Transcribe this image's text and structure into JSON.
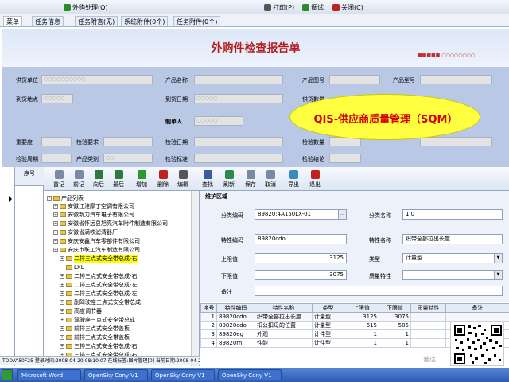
{
  "toolbar": {
    "items": [
      {
        "label": "外购处理(Q)",
        "color": "#2c8a2c"
      },
      {
        "label": "打印(P)",
        "color": "#333333"
      },
      {
        "label": "调试",
        "color": "#2c8a2c"
      },
      {
        "label": "关闭(C)",
        "color": "#c02020"
      }
    ]
  },
  "tabs": [
    {
      "label": "菜单",
      "active": true
    },
    {
      "label": "任务信息"
    },
    {
      "label": "任务附言(无)"
    },
    {
      "label": "系统附件(0个)"
    },
    {
      "label": "任务附件(0个)"
    }
  ],
  "form": {
    "title": "外购件检查报告单",
    "fields_row1": {
      "supplier_label": "供货单位",
      "supplier_value": "○○○○○○○○○○",
      "product_name_label": "产品名称",
      "drawing_no_label": "产品图号",
      "product_code_label": "产品型号"
    },
    "fields_row2": {
      "delivery_place_label": "到货地点",
      "delivery_value": "○○○○○",
      "date_label": "到货日期",
      "date_value": "○○○○○",
      "qty_label": "供货数量"
    },
    "fields_row3": {
      "creator_label": "制单人",
      "creator_value": "○○○○○"
    },
    "fields_row4": {
      "qty_inspect_label": "重要度",
      "req_label": "检验要求",
      "inspect_date_label": "检验日期",
      "check_qty_label": "检验数量"
    },
    "fields_row5": {
      "check_period_label": "检验周期",
      "category_label": "产品类别",
      "category_value": "○○",
      "standard_label": "检验标准",
      "conclusion_label": "检验结论"
    }
  },
  "qis_label": "QIS-供应商质量管理（SQM）",
  "left": {
    "header": "序号"
  },
  "actions": [
    {
      "label": "首记",
      "color": "#7a8aa6"
    },
    {
      "label": "前记",
      "color": "#7a8aa6"
    },
    {
      "label": "向后",
      "color": "#2c7a3c"
    },
    {
      "label": "最后",
      "color": "#2c7a3c"
    },
    {
      "label": "增加",
      "color": "#2c9a2c"
    },
    {
      "label": "删除",
      "color": "#c02020"
    },
    {
      "label": "编辑",
      "color": "#555555"
    },
    {
      "label": "查找",
      "color": "#3a5aa0"
    },
    {
      "label": "刷新",
      "color": "#2c8a4a"
    },
    {
      "label": "保存",
      "color": "#7a8aa6"
    },
    {
      "label": "取消",
      "color": "#7a8aa6"
    },
    {
      "label": "导出",
      "color": "#3a8ac0"
    },
    {
      "label": "退出",
      "color": "#c02020"
    }
  ],
  "tree": {
    "root": "产品列表",
    "items": [
      "安徽江淮摩丁空调有限公司",
      "安徽新力汽车电子有限公司",
      "安徽省怀远县旭亮汽车附件制造有限公司",
      "安徽省满铁滤清器厂",
      "安庆安鑫汽车零部件有限公司",
      "安庆市联工汽车制造有限公司",
      "二排三点式安全带总成-右",
      "LXL",
      "二排三点式安全带总成-右",
      "二排三点式安全带总成-左",
      "二排三点式安全带总成-左",
      "副驾驶座三点式安全带总成",
      "高度调节器",
      "驾驶座三点式安全带总成",
      "前排三点式安全带盖板",
      "前排三点式安全带盖板",
      "三排三点式安全带总成-右",
      "三排三点式安全带总成-右"
    ]
  },
  "maint": {
    "title": "维护区域",
    "class_code_label": "分类编码",
    "class_code_value": "89820:4A150LX-01",
    "class_name_label": "分类名称",
    "class_name_value": "1.0",
    "feature_code_label": "特性编码",
    "feature_code_value": "89820cdo",
    "feature_name_label": "特性名称",
    "feature_name_value": "织带全部拉出长度",
    "upper_label": "上限值",
    "upper_value": "3125",
    "type_label": "类型",
    "type_value": "计量型",
    "lower_label": "下限值",
    "lower_value": "3075",
    "quality_label": "质量特性",
    "quality_value": "",
    "remark_label": "备注"
  },
  "grid": {
    "headers": [
      "序号",
      "特性编码",
      "特性名称",
      "类型",
      "上限值",
      "下限值",
      "质量特性",
      "备注"
    ],
    "rows": [
      [
        "1",
        "89820cdo",
        "织带全部拉出长度",
        "计量型",
        "3125",
        "3075",
        "",
        ""
      ],
      [
        "2",
        "89820cdo",
        "扣公扣母的位置",
        "计量型",
        "615",
        "585",
        "",
        ""
      ],
      [
        "3",
        "89820eg",
        "外观",
        "计件型",
        "1",
        "1",
        "",
        ""
      ],
      [
        "4",
        "89820rn",
        "性能",
        "计件型",
        "1",
        "1",
        "",
        ""
      ]
    ]
  },
  "status": "TODAY50F25  登录时间:2008-04-20 08:10:07  在线标签:图片管理[0]   当前日期:2008-04-20 08:10:40",
  "taskbar": {
    "items": [
      "Microsoft Word",
      "OpenSky Cony V1",
      "OpenSky Cony V1",
      "OpenSky Cony V1"
    ]
  },
  "watermark": "普达"
}
